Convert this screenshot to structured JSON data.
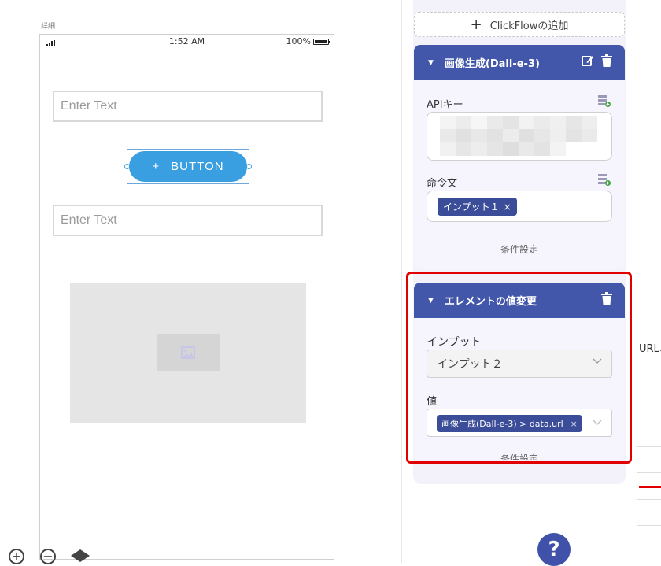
{
  "canvas": {
    "detail_label": "詳細",
    "status": {
      "time": "1:52 AM",
      "battery": "100%"
    },
    "text_input_1": {
      "placeholder": "Enter Text"
    },
    "button": {
      "icon": "+",
      "label": "BUTTON"
    },
    "text_input_2": {
      "placeholder": "Enter Text"
    },
    "image_placeholder_icon": "image-icon",
    "zoom_in": "+",
    "zoom_out": "−"
  },
  "panel": {
    "add_flow": {
      "plus": "+",
      "label": "ClickFlowの追加"
    },
    "card1": {
      "title": "画像生成(Dall-e-3)",
      "api_label": "APIキー",
      "prompt_label": "命令文",
      "prompt_chip": "インプット１",
      "chip_close": "×",
      "condition": "条件設定"
    },
    "card2": {
      "title": "エレメントの値変更",
      "input_label": "インプット",
      "input_value": "インプット２",
      "value_label": "値",
      "value_chip": "画像生成(Dall-e-3) > data.url",
      "chip_close": "×",
      "condition": "条件設定"
    },
    "help": "?",
    "side_text": "URL、"
  },
  "colors": {
    "accent": "#4256aa",
    "button_blue": "#3a9fe0",
    "highlight": "#e00000"
  }
}
